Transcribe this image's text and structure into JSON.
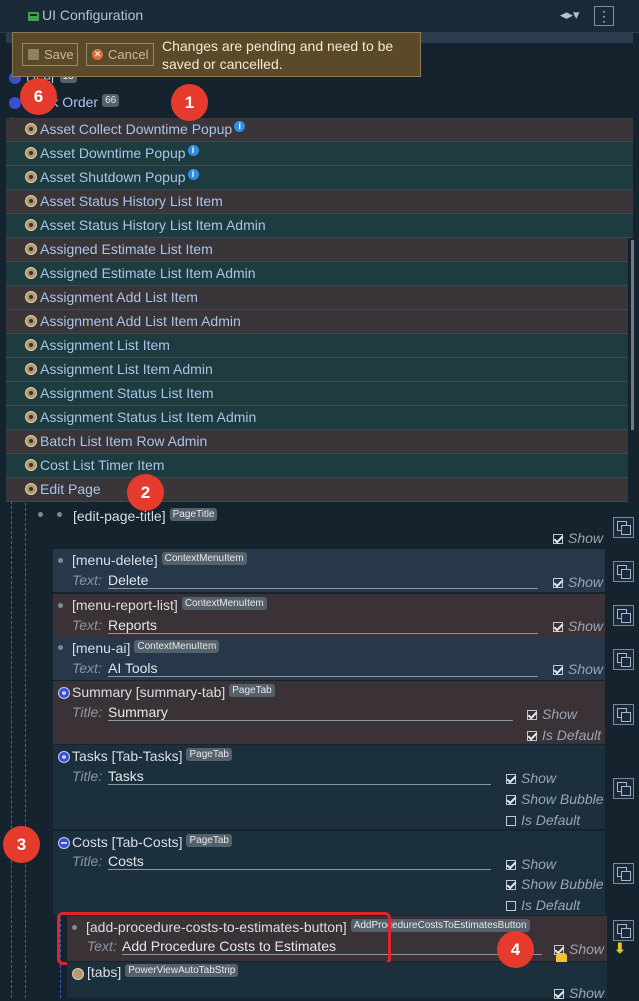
{
  "titlebar": {
    "title": "UI Configuration",
    "code_icon": "code-dropdown-icon",
    "more_icon": "vertical-ellipsis-icon"
  },
  "toast": {
    "save_label": "Save",
    "cancel_label": "Cancel",
    "message": "Changes are pending and need to be saved or cancelled."
  },
  "tree": {
    "user_label": "User",
    "user_count": "13",
    "workorder_label": "Work Order",
    "workorder_count": "66",
    "items": [
      {
        "label": "Asset Collect Downtime Popup",
        "info": true
      },
      {
        "label": "Asset Downtime Popup",
        "info": true
      },
      {
        "label": "Asset Shutdown Popup",
        "info": true
      },
      {
        "label": "Asset Status History List Item",
        "info": false
      },
      {
        "label": "Asset Status History List Item Admin",
        "info": false
      },
      {
        "label": "Assigned Estimate List Item",
        "info": false
      },
      {
        "label": "Assigned Estimate List Item Admin",
        "info": false
      },
      {
        "label": "Assignment Add List Item",
        "info": false
      },
      {
        "label": "Assignment Add List Item Admin",
        "info": false
      },
      {
        "label": "Assignment List Item",
        "info": false
      },
      {
        "label": "Assignment List Item Admin",
        "info": false
      },
      {
        "label": "Assignment Status List Item",
        "info": false
      },
      {
        "label": "Assignment Status List Item Admin",
        "info": false
      },
      {
        "label": "Batch List Item Row Admin",
        "info": false
      },
      {
        "label": "Cost List Timer Item",
        "info": false
      },
      {
        "label": "Edit Page",
        "info": false
      }
    ]
  },
  "editpage": {
    "title_node": {
      "name": "[edit-page-title]",
      "type": "PageTitle",
      "show": "Show"
    },
    "menu_delete": {
      "name": "[menu-delete]",
      "type": "ContextMenuItem",
      "field_label": "Text:",
      "value": "Delete",
      "show": "Show"
    },
    "menu_reports": {
      "name": "[menu-report-list]",
      "type": "ContextMenuItem",
      "field_label": "Text:",
      "value": "Reports",
      "show": "Show"
    },
    "menu_ai": {
      "name": "[menu-ai]",
      "type": "ContextMenuItem",
      "field_label": "Text:",
      "value": "AI Tools",
      "show": "Show"
    },
    "summary_tab": {
      "name": "Summary [summary-tab]",
      "type": "PageTab",
      "field_label": "Title:",
      "value": "Summary",
      "show": "Show",
      "is_default": "Is Default"
    },
    "tasks_tab": {
      "name": "Tasks [Tab-Tasks]",
      "type": "PageTab",
      "field_label": "Title:",
      "value": "Tasks",
      "show": "Show",
      "show_bubble": "Show Bubble",
      "is_default": "Is Default"
    },
    "costs_tab": {
      "name": "Costs [Tab-Costs]",
      "type": "PageTab",
      "field_label": "Title:",
      "value": "Costs",
      "show": "Show",
      "show_bubble": "Show Bubble",
      "is_default": "Is Default"
    },
    "add_btn": {
      "name": "[add-procedure-costs-to-estimates-button]",
      "type": "AddProcedureCostsToEstimatesButton",
      "field_label": "Text:",
      "value": "Add Procedure Costs to Estimates",
      "show": "Show"
    },
    "tabs_node": {
      "name": "[tabs]",
      "type": "PowerViewAutoTabStrip",
      "show": "Show"
    }
  },
  "markers": {
    "m1": "1",
    "m2": "2",
    "m3": "3",
    "m4": "4",
    "m6": "6"
  },
  "colors": {
    "accent": "#e63a2c",
    "toast_bg": "#5a4a29",
    "link": "#a9c4ea",
    "tab_icon": "#3b4fd1"
  }
}
